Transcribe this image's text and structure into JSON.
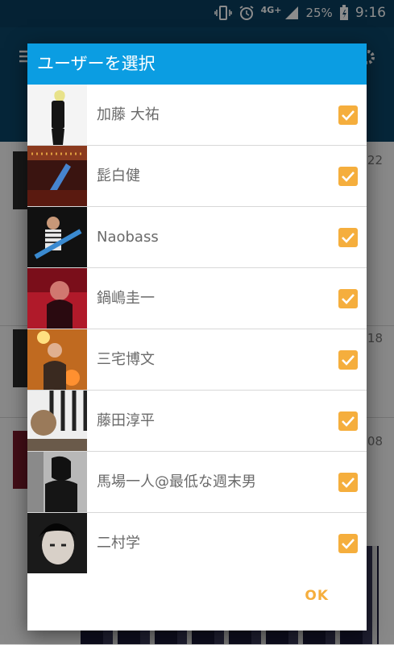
{
  "status_bar": {
    "network": "4G+",
    "battery": "25%",
    "time": "9:16"
  },
  "background": {
    "times": [
      "22",
      "18",
      "08"
    ]
  },
  "dialog": {
    "title": "ユーザーを選択",
    "users": [
      {
        "name": "加藤 大祐",
        "checked": true
      },
      {
        "name": "髭白健",
        "checked": true
      },
      {
        "name": "Naobass",
        "checked": true
      },
      {
        "name": "鍋嶋圭一",
        "checked": true
      },
      {
        "name": "三宅博文",
        "checked": true
      },
      {
        "name": "藤田淳平",
        "checked": true
      },
      {
        "name": "馬場一人@最低な週末男",
        "checked": true
      },
      {
        "name": "二村学",
        "checked": true
      }
    ],
    "ok_label": "OK"
  },
  "colors": {
    "header": "#0b9de2",
    "accent": "#f5ae3d"
  }
}
